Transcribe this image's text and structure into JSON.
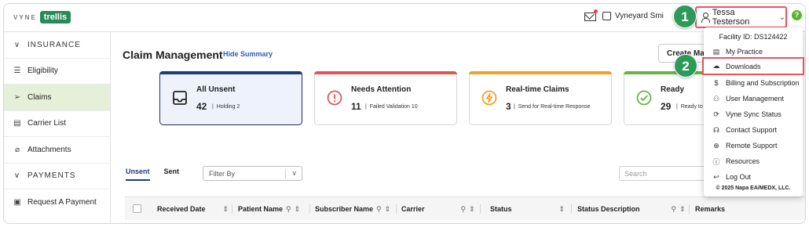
{
  "header": {
    "logo_prefix": "VYNE",
    "logo_name": "trellis",
    "practice_name": "Vyneyard Smi",
    "user_name": "Tessa Testerson",
    "help_label": "?"
  },
  "sidebar": {
    "items": [
      {
        "label": "INSURANCE",
        "icon": "chevron-down-icon",
        "glyph": "∨"
      },
      {
        "label": "Eligibility",
        "icon": "eligibility-icon",
        "glyph": "☰"
      },
      {
        "label": "Claims",
        "icon": "send-icon",
        "glyph": "➢"
      },
      {
        "label": "Carrier List",
        "icon": "list-icon",
        "glyph": "▤"
      },
      {
        "label": "Attachments",
        "icon": "paperclip-icon",
        "glyph": "⌀"
      },
      {
        "label": "PAYMENTS",
        "icon": "chevron-down-icon",
        "glyph": "∨"
      },
      {
        "label": "Request A Payment",
        "icon": "receipt-icon",
        "glyph": "▣"
      }
    ]
  },
  "main": {
    "title": "Claim Management",
    "hide_summary": "Hide Summary",
    "create_label": "Create Ma",
    "cards": [
      {
        "title": "All Unsent",
        "count": "42",
        "sub": "Holding 2",
        "color": "#1f3b7a",
        "icon": "inbox-icon"
      },
      {
        "title": "Needs Attention",
        "count": "11",
        "sub": "Failed Validation 10",
        "color": "#e05656",
        "icon": "alert-icon"
      },
      {
        "title": "Real-time Claims",
        "count": "3",
        "sub": "Send for Real-time Response",
        "color": "#f1a125",
        "icon": "lightning-icon"
      },
      {
        "title": "Ready",
        "count": "29",
        "sub": "Ready to S",
        "color": "#67b545",
        "icon": "check-icon"
      }
    ],
    "tabs": [
      "Unsent",
      "Sent"
    ],
    "filter_placeholder": "Filter By",
    "search_placeholder": "Search",
    "columns": [
      "Received Date",
      "Patient Name",
      "Subscriber Name",
      "Carrier",
      "Status",
      "Status Description",
      "Remarks"
    ]
  },
  "dropdown": {
    "facility": "Facility ID: DS124422",
    "items": [
      {
        "label": "My Practice",
        "icon": "practice-icon",
        "glyph": "▤"
      },
      {
        "label": "Downloads",
        "icon": "cloud-download-icon",
        "glyph": "☁"
      },
      {
        "label": "Billing and Subscription",
        "icon": "dollar-icon",
        "glyph": "$"
      },
      {
        "label": "User Management",
        "icon": "users-icon",
        "glyph": "⚇"
      },
      {
        "label": "Vyne Sync Status",
        "icon": "sync-icon",
        "glyph": "⟳"
      },
      {
        "label": "Contact Support",
        "icon": "headset-icon",
        "glyph": "☊"
      },
      {
        "label": "Remote Support",
        "icon": "globe-icon",
        "glyph": "⊕"
      },
      {
        "label": "Resources",
        "icon": "info-icon",
        "glyph": "ⓘ"
      },
      {
        "label": "Log Out",
        "icon": "logout-icon",
        "glyph": "↩"
      }
    ],
    "copyright": "© 2025 Napa EA/MEDX, LLC."
  },
  "callouts": [
    "1",
    "2"
  ]
}
